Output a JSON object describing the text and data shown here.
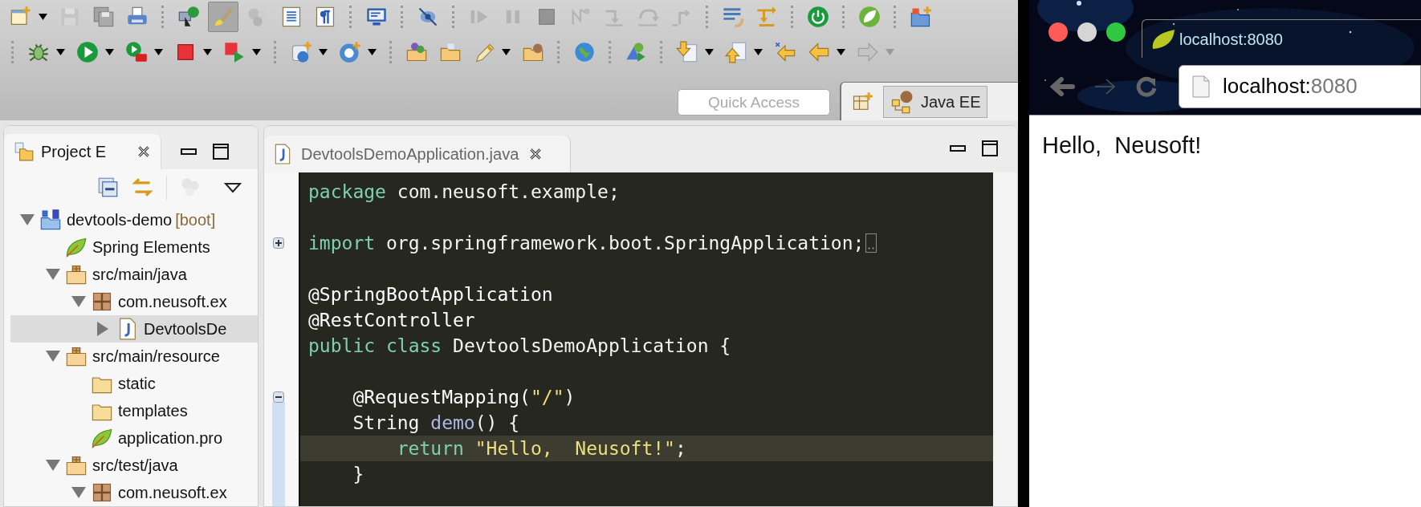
{
  "toolbar_rows": [
    [
      {
        "kind": "new",
        "dropdown": true,
        "disabled": false,
        "pressed": false
      },
      {
        "kind": "save",
        "dropdown": false,
        "disabled": true,
        "pressed": false
      },
      {
        "kind": "saveall",
        "dropdown": false,
        "disabled": true,
        "pressed": false
      },
      {
        "kind": "print",
        "dropdown": false,
        "disabled": false,
        "pressed": false
      },
      {
        "kind": "sep"
      },
      {
        "kind": "opentype",
        "dropdown": false,
        "disabled": false,
        "pressed": false
      },
      {
        "kind": "brush",
        "dropdown": false,
        "disabled": false,
        "pressed": true
      },
      {
        "kind": "gears",
        "dropdown": false,
        "disabled": true,
        "pressed": false
      },
      {
        "kind": "block",
        "dropdown": false,
        "disabled": false,
        "pressed": false
      },
      {
        "kind": "pilcrow",
        "dropdown": false,
        "disabled": false,
        "pressed": false
      },
      {
        "kind": "sep"
      },
      {
        "kind": "monitor",
        "dropdown": false,
        "disabled": false,
        "pressed": false
      },
      {
        "kind": "sep"
      },
      {
        "kind": "noeye",
        "dropdown": false,
        "disabled": false,
        "pressed": false
      },
      {
        "kind": "sep"
      },
      {
        "kind": "resume",
        "dropdown": false,
        "disabled": true,
        "pressed": false
      },
      {
        "kind": "suspend",
        "dropdown": false,
        "disabled": true,
        "pressed": false
      },
      {
        "kind": "stop",
        "dropdown": false,
        "disabled": true,
        "pressed": false
      },
      {
        "kind": "disconnect",
        "dropdown": false,
        "disabled": true,
        "pressed": false
      },
      {
        "kind": "stepinto",
        "dropdown": false,
        "disabled": true,
        "pressed": false
      },
      {
        "kind": "stepover",
        "dropdown": false,
        "disabled": true,
        "pressed": false
      },
      {
        "kind": "stepreturn",
        "dropdown": false,
        "disabled": true,
        "pressed": false
      },
      {
        "kind": "sep"
      },
      {
        "kind": "dropframe",
        "dropdown": false,
        "disabled": false,
        "pressed": false
      },
      {
        "kind": "stepfilter",
        "dropdown": false,
        "disabled": false,
        "pressed": false
      },
      {
        "kind": "sep"
      },
      {
        "kind": "power",
        "dropdown": false,
        "disabled": false,
        "pressed": false
      },
      {
        "kind": "sep"
      },
      {
        "kind": "leaf",
        "dropdown": false,
        "disabled": false,
        "pressed": false
      },
      {
        "kind": "sep"
      },
      {
        "kind": "folderplus",
        "dropdown": false,
        "disabled": false,
        "pressed": false
      }
    ],
    [
      {
        "kind": "sep"
      },
      {
        "kind": "bug",
        "dropdown": true,
        "disabled": false,
        "pressed": false
      },
      {
        "kind": "run",
        "dropdown": true,
        "disabled": false,
        "pressed": false
      },
      {
        "kind": "runtools",
        "dropdown": true,
        "disabled": false,
        "pressed": false
      },
      {
        "kind": "stop",
        "dropdown": true,
        "disabled": false,
        "pressed": false
      },
      {
        "kind": "stoprun",
        "dropdown": true,
        "disabled": false,
        "pressed": false
      },
      {
        "kind": "sep"
      },
      {
        "kind": "server",
        "dropdown": true,
        "disabled": false,
        "pressed": false
      },
      {
        "kind": "bean",
        "dropdown": true,
        "disabled": false,
        "pressed": false
      },
      {
        "kind": "sep"
      },
      {
        "kind": "folderballs",
        "dropdown": false,
        "disabled": false,
        "pressed": false
      },
      {
        "kind": "folder",
        "dropdown": false,
        "disabled": false,
        "pressed": false
      },
      {
        "kind": "pen",
        "dropdown": true,
        "disabled": false,
        "pressed": false
      },
      {
        "kind": "folderweb",
        "dropdown": false,
        "disabled": false,
        "pressed": false
      },
      {
        "kind": "sep"
      },
      {
        "kind": "globe",
        "dropdown": false,
        "disabled": false,
        "pressed": false
      },
      {
        "kind": "sep"
      },
      {
        "kind": "deploy",
        "dropdown": false,
        "disabled": false,
        "pressed": false
      },
      {
        "kind": "sep"
      },
      {
        "kind": "down",
        "dropdown": true,
        "disabled": false,
        "pressed": false
      },
      {
        "kind": "up",
        "dropdown": true,
        "disabled": false,
        "pressed": false
      },
      {
        "kind": "lastedit",
        "dropdown": false,
        "disabled": false,
        "pressed": false
      },
      {
        "kind": "back",
        "dropdown": true,
        "disabled": false,
        "pressed": false
      },
      {
        "kind": "forward",
        "dropdown": true,
        "disabled": true,
        "pressed": false
      }
    ]
  ],
  "quick_access": {
    "placeholder": "Quick Access"
  },
  "perspectives": [
    {
      "label": "Java EE",
      "selected": true
    }
  ],
  "project_explorer": {
    "tab_title": "Project E",
    "tree": [
      {
        "label": "devtools-demo",
        "suffix": "[boot]",
        "kind": "project",
        "expanded": true,
        "selected": false,
        "children": [
          {
            "label": "Spring Elements",
            "kind": "leaf",
            "selected": false
          },
          {
            "label": "src/main/java",
            "kind": "srcfolder",
            "expanded": true,
            "selected": false,
            "children": [
              {
                "label": "com.neusoft.ex",
                "kind": "package",
                "expanded": true,
                "selected": false,
                "children": [
                  {
                    "label": "DevtoolsDe",
                    "kind": "java",
                    "expanded": false,
                    "selected": true
                  }
                ]
              }
            ]
          },
          {
            "label": "src/main/resource",
            "kind": "srcfolder",
            "expanded": true,
            "selected": false,
            "children": [
              {
                "label": "static",
                "kind": "folder",
                "selected": false
              },
              {
                "label": "templates",
                "kind": "folder",
                "selected": false
              },
              {
                "label": "application.pro",
                "kind": "leaf",
                "selected": false
              }
            ]
          },
          {
            "label": "src/test/java",
            "kind": "srcfolder",
            "expanded": true,
            "selected": false,
            "children": [
              {
                "label": "com.neusoft.ex",
                "kind": "package",
                "expanded": true,
                "selected": false
              }
            ]
          }
        ]
      }
    ]
  },
  "editor": {
    "tab_title": "DevtoolsDemoApplication.java",
    "lines": [
      {
        "kind": "plain",
        "current": false,
        "tokens": [
          {
            "kind": "keyword",
            "text": "package"
          },
          {
            "kind": "plain",
            "text": " com.neusoft.example;"
          }
        ]
      },
      {
        "kind": "plain",
        "current": false
      },
      {
        "kind": "fold_collapsed",
        "current": false,
        "tokens": [
          {
            "kind": "keyword",
            "text": "import"
          },
          {
            "kind": "plain",
            "text": " org.springframework.boot.SpringApplication;"
          }
        ]
      },
      {
        "kind": "plain",
        "current": false
      },
      {
        "kind": "plain",
        "current": false,
        "tokens": [
          {
            "kind": "annotation",
            "text": "@SpringBootApplication"
          }
        ]
      },
      {
        "kind": "plain",
        "current": false,
        "tokens": [
          {
            "kind": "annotation",
            "text": "@RestController"
          }
        ]
      },
      {
        "kind": "plain",
        "current": false,
        "tokens": [
          {
            "kind": "keyword",
            "text": "public"
          },
          {
            "kind": "keyword",
            "text": " class"
          },
          {
            "kind": "plain",
            "text": " DevtoolsDemoApplication {"
          }
        ]
      },
      {
        "kind": "plain",
        "current": false
      },
      {
        "kind": "fold_expanded",
        "current": false,
        "tokens": [
          {
            "kind": "annotation",
            "text": "    @RequestMapping("
          },
          {
            "kind": "string",
            "text": "\"/\""
          },
          {
            "kind": "plain",
            "text": ")"
          }
        ]
      },
      {
        "kind": "plain",
        "current": false,
        "tokens": [
          {
            "kind": "plain",
            "text": "    String "
          },
          {
            "kind": "method",
            "text": "demo"
          },
          {
            "kind": "plain",
            "text": "() {"
          }
        ]
      },
      {
        "kind": "plain",
        "current": true,
        "tokens": [
          {
            "kind": "keyword",
            "text": "        return"
          },
          {
            "kind": "string",
            "text": " \"Hello,  Neusoft!\""
          },
          {
            "kind": "plain",
            "text": ";"
          }
        ]
      },
      {
        "kind": "plain",
        "current": false,
        "tokens": [
          {
            "kind": "plain",
            "text": "    }"
          }
        ]
      }
    ]
  },
  "browser": {
    "tab_title": "localhost:8080",
    "url": {
      "host": "localhost:",
      "port": "8080"
    },
    "page_text": "Hello,  Neusoft!"
  }
}
